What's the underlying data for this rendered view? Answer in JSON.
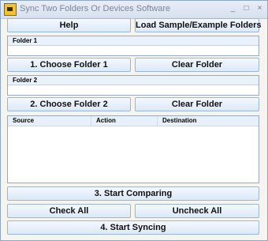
{
  "window": {
    "title": "Sync Two Folders Or Devices Software"
  },
  "title_buttons": {
    "minimize": "_",
    "maximize": "□",
    "close": "×"
  },
  "toolbar": {
    "help": "Help",
    "load_sample": "Load Sample/Example Folders"
  },
  "folder1": {
    "label": "Folder 1",
    "value": "",
    "choose": "1. Choose Folder 1",
    "clear": "Clear Folder"
  },
  "folder2": {
    "label": "Folder 2",
    "value": "",
    "choose": "2. Choose Folder 2",
    "clear": "Clear Folder"
  },
  "results": {
    "columns": [
      "Source",
      "Action",
      "Destination"
    ]
  },
  "actions": {
    "start_comparing": "3. Start Comparing",
    "check_all": "Check All",
    "uncheck_all": "Uncheck All",
    "start_syncing": "4. Start Syncing"
  },
  "colors": {
    "button_border": "#9eb6cf",
    "window_bg": "#f5f4ef",
    "header_bg": "#e8f1fb"
  }
}
